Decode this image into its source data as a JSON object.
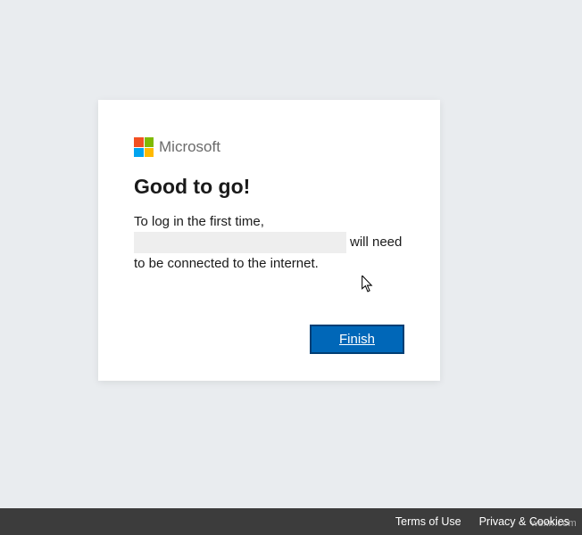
{
  "brand": {
    "name": "Microsoft"
  },
  "dialog": {
    "title": "Good to go!",
    "body_prefix": "To log in the first time, ",
    "redacted_email": "██████████████████████",
    "body_suffix": " will need to be connected to the internet.",
    "finish_button": "Finish"
  },
  "footer": {
    "terms": "Terms of Use",
    "privacy": "Privacy & Cookies"
  },
  "watermark": "wsxn.com"
}
